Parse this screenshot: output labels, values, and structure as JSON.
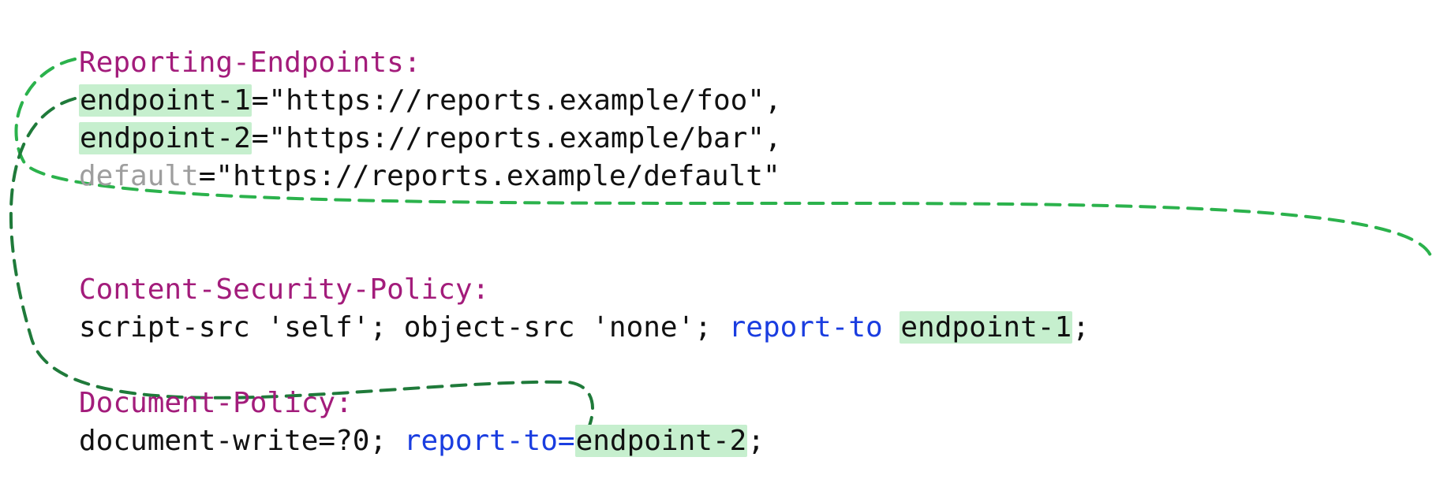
{
  "reporting": {
    "header": "Reporting-Endpoints:",
    "endpoint1_name": "endpoint-1",
    "endpoint1_rest": "=\"https://reports.example/foo\",",
    "endpoint2_name": "endpoint-2",
    "endpoint2_rest": "=\"https://reports.example/bar\",",
    "default_name": "default",
    "default_rest": "=\"https://reports.example/default\""
  },
  "csp": {
    "header": "Content-Security-Policy:",
    "body_before": "script-src 'self'; object-src 'none'; ",
    "report_to": "report-to",
    "space": " ",
    "endpoint": "endpoint-1",
    "terminator": ";"
  },
  "docpolicy": {
    "header": "Document-Policy:",
    "body_before": "document-write=?0; ",
    "report_to": "report-to=",
    "endpoint": "endpoint-2",
    "terminator": ";"
  },
  "arrows": {
    "desc1": "dashed green arrow from endpoint-1 definition to CSP report-to endpoint-1",
    "desc2": "dashed dark-green arrow from endpoint-2 definition to Document-Policy report-to endpoint-2"
  }
}
